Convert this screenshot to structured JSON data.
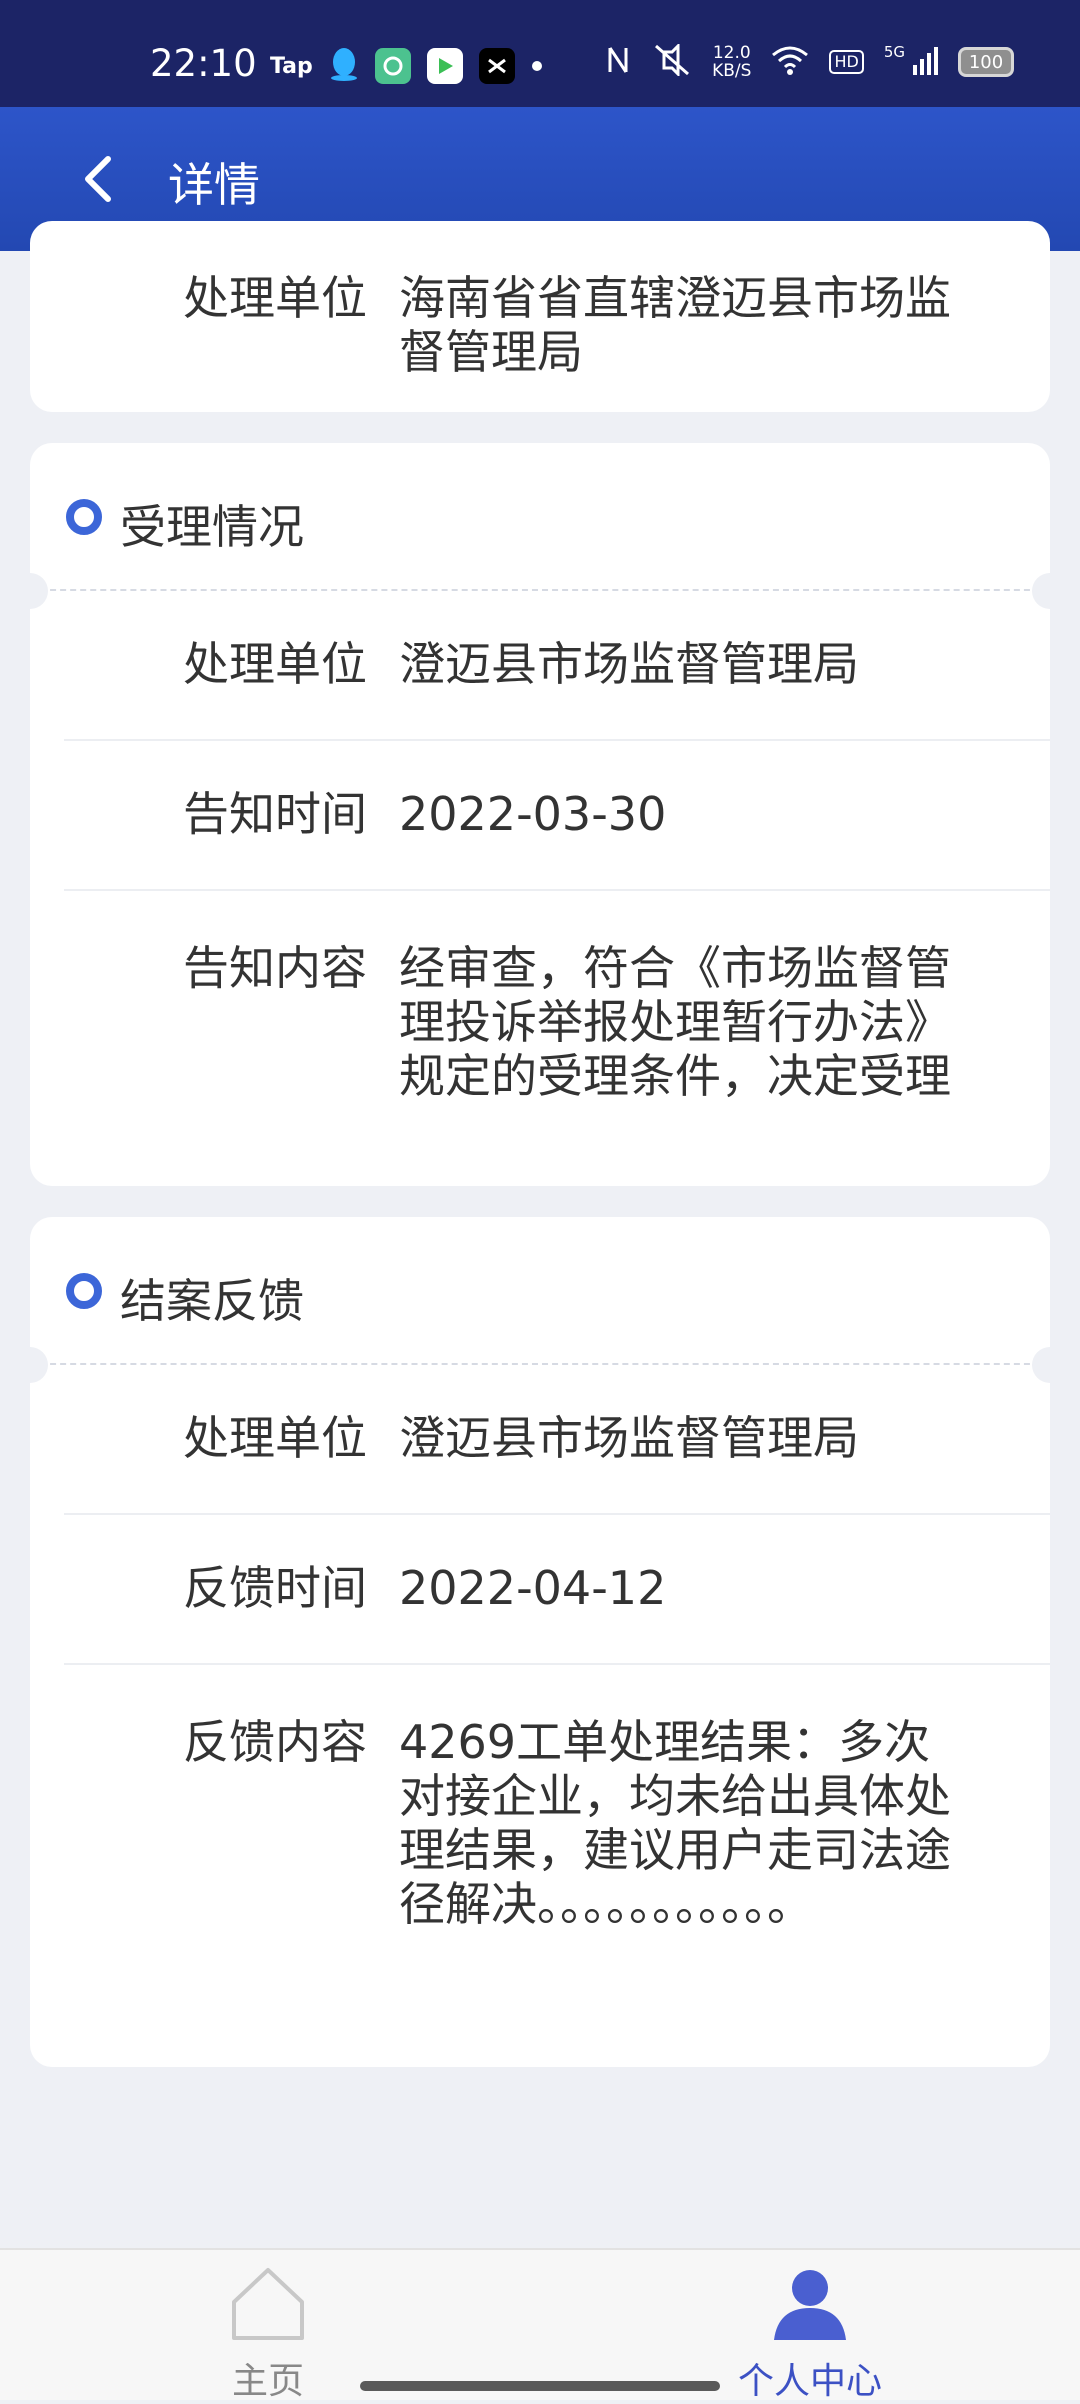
{
  "status": {
    "time": "22:10",
    "tap_label": "Tap",
    "network_speed_value": "12.0",
    "network_speed_unit": "KB/S",
    "hd_label": "HD",
    "signal_label": "5G",
    "battery": "100"
  },
  "header": {
    "title": "详情"
  },
  "top_card": {
    "rows": [
      {
        "label": "处理单位",
        "value": "海南省省直辖澄迈县市场监督管理局"
      }
    ]
  },
  "acceptance": {
    "title": "受理情况",
    "rows": [
      {
        "label": "处理单位",
        "value": "澄迈县市场监督管理局"
      },
      {
        "label": "告知时间",
        "value": "2022-03-30"
      },
      {
        "label": "告知内容",
        "value": "经审查，符合《市场监督管理投诉举报处理暂行办法》规定的受理条件，决定受理"
      }
    ]
  },
  "closure": {
    "title": "结案反馈",
    "rows": [
      {
        "label": "处理单位",
        "value": "澄迈县市场监督管理局"
      },
      {
        "label": "反馈时间",
        "value": "2022-04-12"
      },
      {
        "label": "反馈内容",
        "value": "4269工单处理结果：多次对接企业，均未给出具体处理结果，建议用户走司法途径解决。。。。。。。。。。。"
      }
    ]
  },
  "bottom_nav": {
    "home_label": "主页",
    "me_label": "个人中心"
  },
  "colors": {
    "accent": "#3c66d8",
    "header_bg": "#2d55c9",
    "status_bg": "#1c2466"
  }
}
